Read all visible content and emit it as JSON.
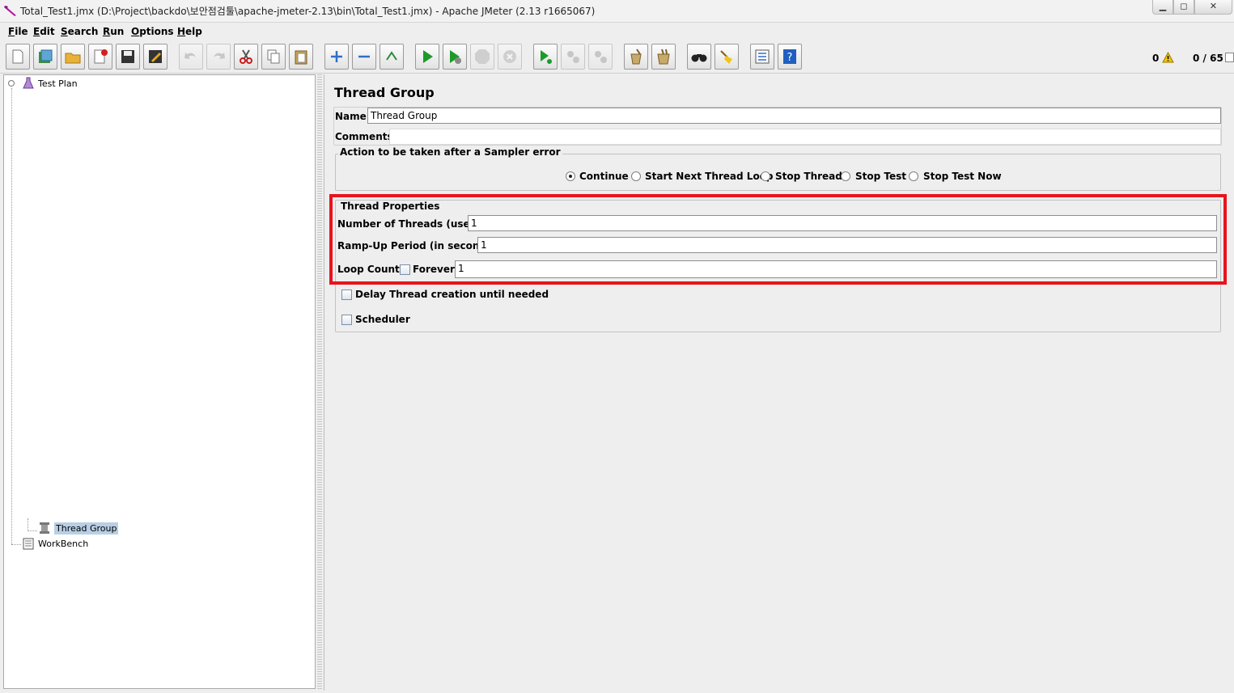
{
  "window": {
    "title": "Total_Test1.jmx (D:\\Project\\backdo\\보안점검툴\\apache-jmeter-2.13\\bin\\Total_Test1.jmx) - Apache JMeter (2.13 r1665067)",
    "min_glyph": "▁",
    "max_glyph": "◻",
    "close_glyph": "✕"
  },
  "menu": {
    "file": {
      "u": "F",
      "rest": "ile"
    },
    "edit": {
      "u": "E",
      "rest": "dit"
    },
    "search": {
      "u": "S",
      "rest": "earch"
    },
    "run": {
      "u": "R",
      "rest": "un"
    },
    "options": {
      "u": "O",
      "rest": "ptions"
    },
    "help": {
      "u": "H",
      "rest": "elp"
    }
  },
  "toolbar": {
    "error_count": "0",
    "thread_count": "0 / 65",
    "icons": [
      "new-icon",
      "templates-icon",
      "open-icon",
      "close-file-icon",
      "save-icon",
      "save-as-icon",
      "undo-icon",
      "redo-icon",
      "cut-icon",
      "copy-icon",
      "paste-icon",
      "expand-icon",
      "collapse-icon",
      "toggle-icon",
      "start-icon",
      "start-no-pause-icon",
      "stop-icon",
      "shutdown-icon",
      "remote-start-icon",
      "remote-stop-icon",
      "remote-shutdown-icon",
      "clear-icon",
      "clear-all-icon",
      "search-icon",
      "reset-search-icon",
      "function-helper-icon",
      "help-icon"
    ]
  },
  "tree": {
    "items": [
      {
        "label": "Test Plan"
      },
      {
        "label": "Thread Group"
      },
      {
        "label": "WorkBench"
      }
    ]
  },
  "thread_group": {
    "title": "Thread Group",
    "name_label": "Name:",
    "name_value": "Thread Group",
    "comments_label": "Comments:",
    "comments_value": "",
    "error_action": {
      "legend": "Action to be taken after a Sampler error",
      "options": [
        {
          "label": "Continue",
          "selected": true
        },
        {
          "label": "Start Next Thread Loop",
          "selected": false
        },
        {
          "label": "Stop Thread",
          "selected": false
        },
        {
          "label": "Stop Test",
          "selected": false
        },
        {
          "label": "Stop Test Now",
          "selected": false
        }
      ]
    },
    "thread_properties": {
      "legend": "Thread Properties",
      "threads_label": "Number of Threads (users):",
      "threads_value": "1",
      "rampup_label": "Ramp-Up Period (in seconds):",
      "rampup_value": "1",
      "loop_label": "Loop Count:",
      "forever_label": "Forever",
      "forever_checked": false,
      "loop_value": "1"
    },
    "delay_label": "Delay Thread creation until needed",
    "delay_checked": false,
    "scheduler_label": "Scheduler",
    "scheduler_checked": false
  },
  "colors": {
    "highlight": "#e8141c",
    "selection": "#b8cfe5"
  }
}
